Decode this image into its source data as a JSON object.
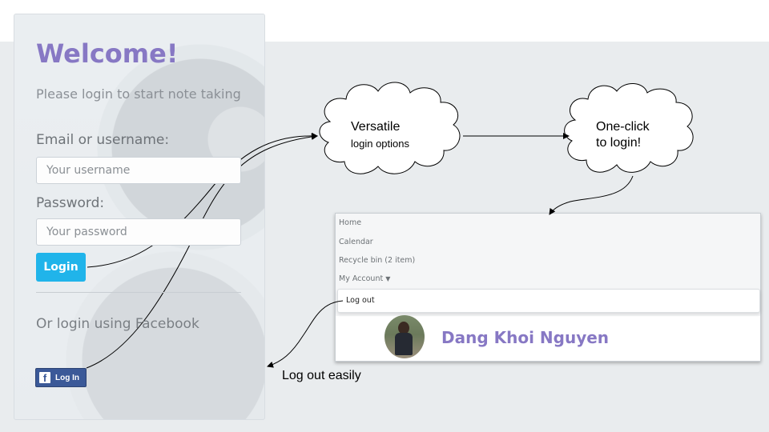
{
  "login": {
    "title": "Welcome!",
    "subtitle": "Please login to start note taking",
    "email_label": "Email or username:",
    "email_placeholder": "Your username",
    "password_label": "Password:",
    "password_placeholder": "Your password",
    "login_button": "Login",
    "facebook_prompt": "Or login using Facebook",
    "facebook_button": "Log In"
  },
  "callouts": {
    "cloud1_line1": "Versatile",
    "cloud1_line2": "login options",
    "cloud2_line1": "One-click",
    "cloud2_line2": "to login!",
    "logout_caption": "Log out easily"
  },
  "account_panel": {
    "nav": [
      "Home",
      "Calendar",
      "Recycle bin (2 item)"
    ],
    "account_menu": "My Account",
    "logout": "Log out",
    "user_name": "Dang Khoi Nguyen"
  },
  "colors": {
    "brand_purple": "#8778c4",
    "login_blue": "#20b4ea",
    "facebook_blue": "#3b5998"
  }
}
